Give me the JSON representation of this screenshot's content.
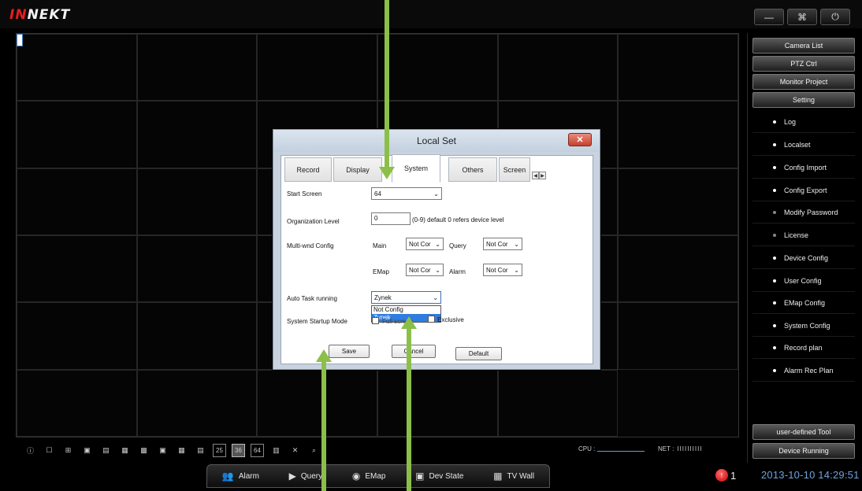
{
  "app": {
    "logo_part1": "IN",
    "logo_part2": "NEKT"
  },
  "window_controls": {
    "minimize": "—",
    "maximize": "⌘",
    "power": "⏻"
  },
  "right_panel": {
    "top_buttons": [
      "Camera List",
      "PTZ Ctrl",
      "Monitor Project",
      "Setting"
    ],
    "menu": [
      "Log",
      "Localset",
      "Config Import",
      "Config Export",
      "Modify Password",
      "License",
      "Device Config",
      "User Config",
      "EMap Config",
      "System Config",
      "Record plan",
      "Alarm Rec Plan"
    ],
    "bottom_buttons": [
      "user-defined Tool",
      "Device Running"
    ]
  },
  "layout_bar": {
    "text_buttons": [
      "25",
      "36",
      "64"
    ],
    "cpu_label": "CPU :",
    "net_label": "NET :",
    "net_bars": "IIIIIIIIII"
  },
  "bottom_tabs": [
    "Alarm",
    "Query",
    "EMap",
    "Dev State",
    "TV Wall"
  ],
  "status": {
    "alarm_count": "1",
    "datetime": "2013-10-10 14:29:51"
  },
  "dialog": {
    "title": "Local Set",
    "close": "✕",
    "tabs": [
      "Record",
      "Display",
      "System",
      "Others",
      "Screen"
    ],
    "active_tab": "System",
    "fields": {
      "start_screen_label": "Start Screen",
      "start_screen_value": "64",
      "org_level_label": "Organization Level",
      "org_level_value": "0",
      "org_level_hint": "(0-9) default 0 refers device level",
      "multi_wnd_label": "Multi-wnd Config",
      "main_label": "Main",
      "main_value": "Not Cor",
      "query_label": "Query",
      "query_value": "Not Cor",
      "emap_label": "EMap",
      "emap_value": "Not Cor",
      "alarm_label": "Alarm",
      "alarm_value": "Not Cor",
      "auto_task_label": "Auto Task running",
      "auto_task_value": "Zynek",
      "auto_task_options": [
        "Not Config",
        "Zynek"
      ],
      "startup_mode_label": "System Startup Mode",
      "fullscreen_label": "Full screen",
      "exclusive_label": "Exclusive"
    },
    "buttons": {
      "save": "Save",
      "cancel": "Cancel",
      "default": "Default"
    }
  },
  "colors": {
    "annotation_arrow": "#8cbf4a",
    "date_text": "#6ea3dd",
    "logo_red": "#e81c1c"
  }
}
